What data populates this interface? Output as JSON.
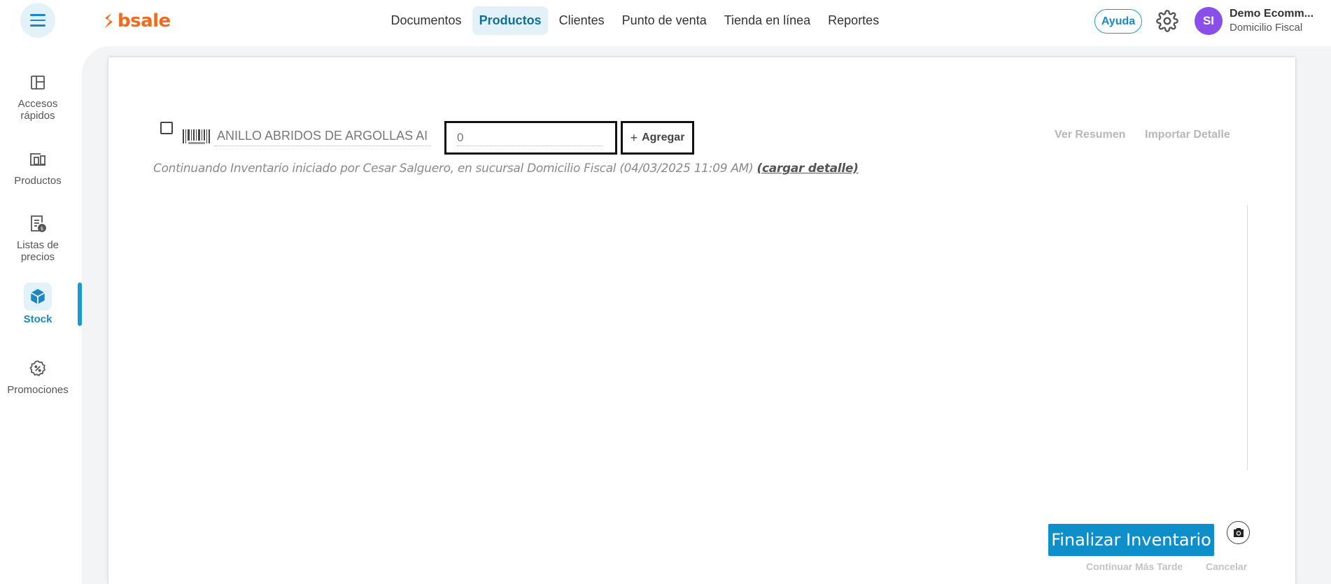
{
  "header": {
    "logo_text": "bsale",
    "nav": [
      {
        "label": "Documentos"
      },
      {
        "label": "Productos"
      },
      {
        "label": "Clientes"
      },
      {
        "label": "Punto de venta"
      },
      {
        "label": "Tienda en línea"
      },
      {
        "label": "Reportes"
      }
    ],
    "active_nav": "Productos",
    "help_label": "Ayuda",
    "user_initials": "SI",
    "user_name": "Demo Ecomm...",
    "user_branch": "Domicilio Fiscal",
    "accent_color": "#1a9bd0",
    "brand_color": "#f26b1d",
    "avatar_color": "#8a4fe8"
  },
  "sidebar": {
    "items": [
      {
        "label_line1": "Accesos",
        "label_line2": "rápidos",
        "icon": "layout-icon"
      },
      {
        "label_line1": "Productos",
        "label_line2": "",
        "icon": "products-icon"
      },
      {
        "label_line1": "Listas de",
        "label_line2": "precios",
        "icon": "price-list-icon"
      },
      {
        "label_line1": "Stock",
        "label_line2": "",
        "icon": "box-icon"
      },
      {
        "label_line1": "Promociones",
        "label_line2": "",
        "icon": "promo-icon"
      }
    ],
    "active_item": "Stock"
  },
  "inventory": {
    "product_value": "ANILLO ABRIDOS DE ARGOLLAS AI",
    "quantity_value": "0",
    "add_label": "Agregar",
    "ver_resumen_label": "Ver Resumen",
    "importar_label": "Importar Detalle",
    "note_text": "Continuando Inventario iniciado por Cesar Salguero, en sucursal Domicilio Fiscal (04/03/2025 11:09 AM) ",
    "note_link": "(cargar detalle)",
    "finalize_label": "Finalizar Inventario",
    "continue_later_label": "Continuar Más Tarde",
    "cancel_label": "Cancelar"
  }
}
